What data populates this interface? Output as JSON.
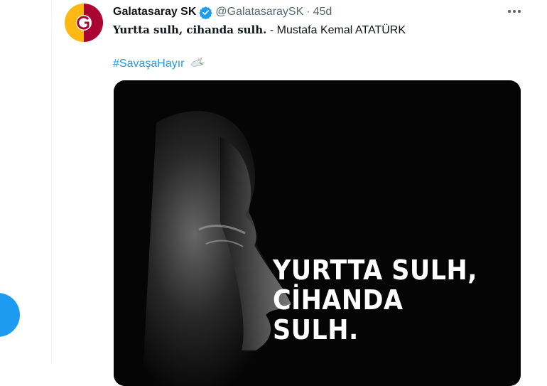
{
  "tweet": {
    "display_name": "Galatasaray SK",
    "handle": "@GalatasaraySK",
    "separator": "·",
    "time": "45d",
    "quote_bold": "Yurtta sulh, cihanda sulh.",
    "quote_attribution": " - Mustafa Kemal ATATÜRK",
    "hashtag": "#SavaşaHayır",
    "hashtag_emoji": "dove-icon",
    "more_icon": "more-horizontal-icon",
    "verified_icon": "verified-badge-icon"
  },
  "media": {
    "line1": "YURTTA SULH,",
    "line2": "CİHANDA SULH."
  },
  "colors": {
    "accent": "#1d9bf0",
    "text": "#0f1419",
    "secondary": "#536471",
    "logo_red": "#a90432",
    "logo_yellow": "#fdb912"
  }
}
